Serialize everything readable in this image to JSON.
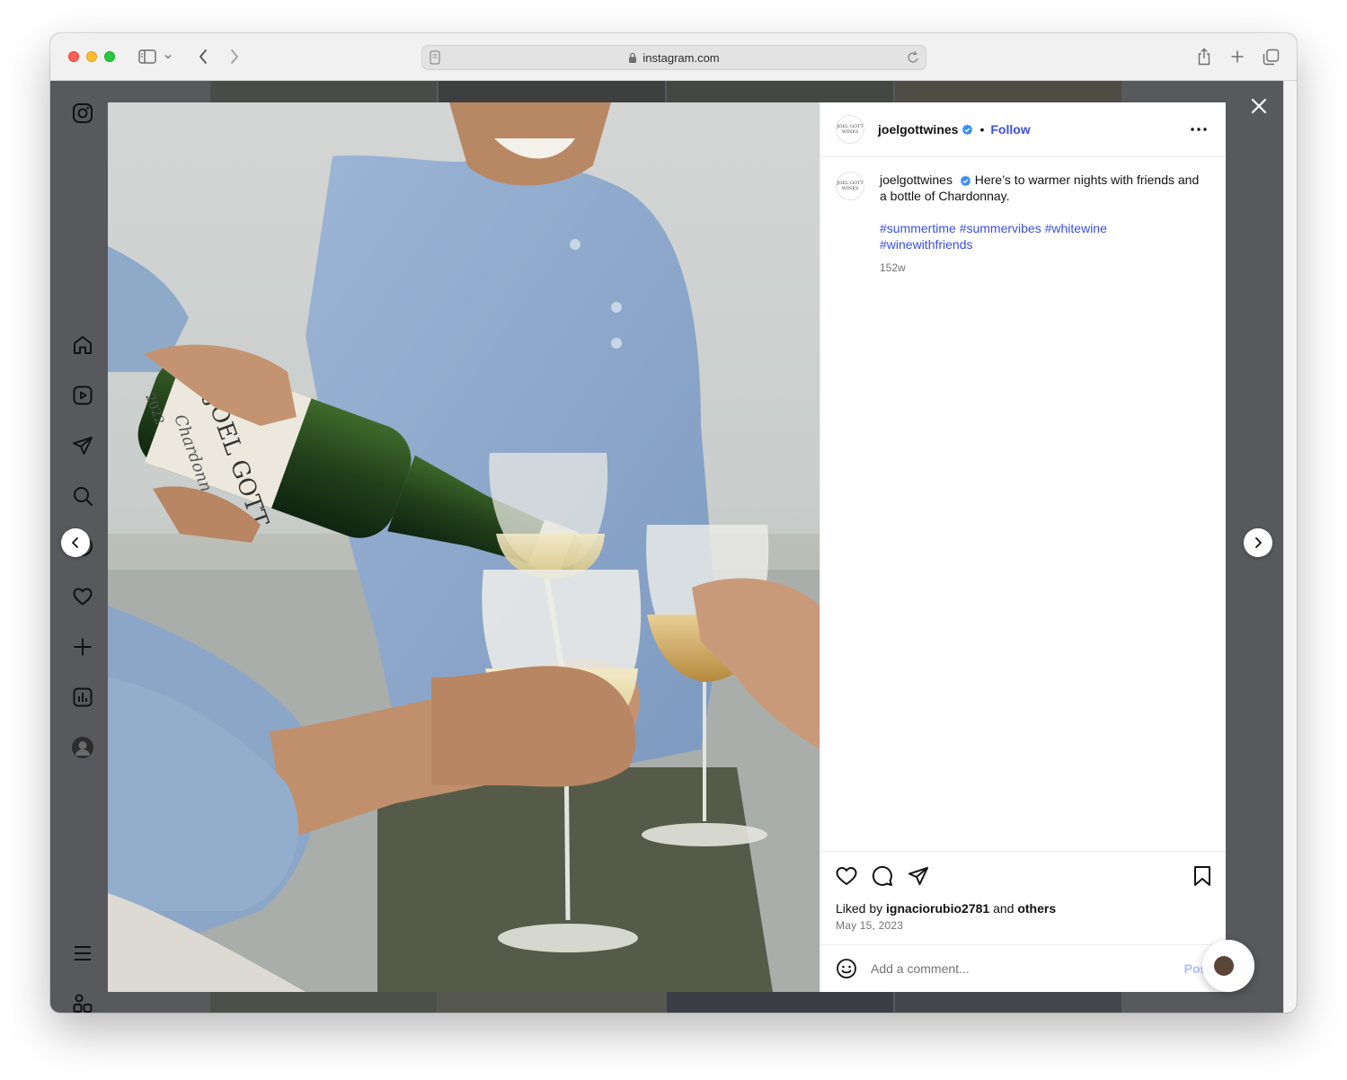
{
  "browser": {
    "url": "instagram.com"
  },
  "post": {
    "username": "joelgottwines",
    "follow_label": "Follow",
    "avatar_text": [
      "JOEL GOTT",
      "WINES"
    ],
    "caption": "Here’s to warmer nights with friends and a bottle of Chardonnay.",
    "hashtags": [
      "#summertime",
      "#summervibes",
      "#whitewine",
      "#winewithfriends"
    ],
    "age": "152w",
    "liked_by_prefix": "Liked by",
    "liked_by_user": "ignaciorubio2781",
    "liked_by_and": "and",
    "liked_by_others": "others",
    "date": "May 15, 2023",
    "comment_placeholder": "Add a comment...",
    "post_label": "Post"
  },
  "bottle_label": {
    "brand": "JOEL GOTT",
    "varietal": "Chardonnay",
    "vintage": "2022"
  },
  "colors": {
    "link": "#3c4fe0",
    "verified": "#3d8cf5",
    "overlay": "#58595d"
  },
  "icons": {
    "sidebar": [
      "instagram-icon",
      "home-icon",
      "reels-icon",
      "direct-icon",
      "search-icon",
      "explore-icon",
      "heart-icon",
      "create-icon",
      "insights-icon",
      "profile-avatar",
      "menu-icon",
      "more-apps-icon"
    ],
    "actions": [
      "heart-icon",
      "comment-icon",
      "share-icon",
      "bookmark-icon"
    ]
  }
}
